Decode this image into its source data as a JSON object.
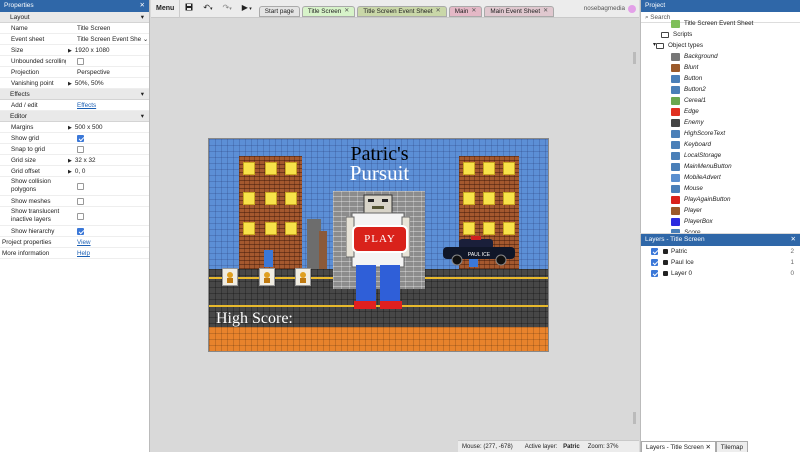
{
  "properties": {
    "title": "Properties",
    "sections": {
      "layout": "Layout",
      "effects": "Effects",
      "editor": "Editor"
    },
    "layout_rows": [
      {
        "key": "Name",
        "value": "Title Screen"
      },
      {
        "key": "Event sheet",
        "value": "Title Screen Event She"
      },
      {
        "key": "Size",
        "value": "1920 x 1080"
      },
      {
        "key": "Unbounded scrolling",
        "value": ""
      },
      {
        "key": "Projection",
        "value": "Perspective"
      },
      {
        "key": "Vanishing point",
        "value": "50%, 50%"
      }
    ],
    "effects_rows": [
      {
        "key": "Add / edit",
        "value": "Effects"
      }
    ],
    "editor_rows": [
      {
        "key": "Margins",
        "value": "500 x 500"
      },
      {
        "key": "Show grid",
        "value": ""
      },
      {
        "key": "Snap to grid",
        "value": ""
      },
      {
        "key": "Grid size",
        "value": "32 x 32"
      },
      {
        "key": "Grid offset",
        "value": "0, 0"
      },
      {
        "key": "Show collision polygons",
        "value": ""
      },
      {
        "key": "Show meshes",
        "value": ""
      },
      {
        "key": "Show translucent inactive layers",
        "value": ""
      },
      {
        "key": "Show hierarchy",
        "value": ""
      }
    ],
    "footer_rows": [
      {
        "key": "Project properties",
        "value": "View"
      },
      {
        "key": "More information",
        "value": "Help"
      }
    ],
    "checks": {
      "unbounded_scrolling": false,
      "show_grid": true,
      "snap_to_grid": false,
      "show_collision_polygons": false,
      "show_meshes": false,
      "show_translucent_inactive_layers": false,
      "show_hierarchy": true
    }
  },
  "toolbar": {
    "menu_label": "Menu",
    "save_icon": "save-icon",
    "undo_icon": "undo-icon",
    "redo_icon": "redo-icon",
    "play_icon": "play-icon"
  },
  "tabs": [
    {
      "label": "Start page",
      "color": "#e4e4e4",
      "closable": false
    },
    {
      "label": "Title Screen",
      "color": "#d7f3c9",
      "closable": true
    },
    {
      "label": "Title Screen Event Sheet",
      "color": "#c9d7a8",
      "closable": true
    },
    {
      "label": "Main",
      "color": "#e4b8c6",
      "closable": true
    },
    {
      "label": "Main Event Sheet",
      "color": "#e0c8cf",
      "closable": true
    }
  ],
  "user": "nosebagmedia",
  "scene": {
    "title_line1": "Patric's",
    "title_line2": "Pursuit",
    "play_label": "PLAY",
    "high_score_label": "High Score:",
    "car_label": "PAUL ICE"
  },
  "status": {
    "mouse": "Mouse: (277, -678)",
    "active_layer_label": "Active layer:",
    "active_layer_value": "Patric",
    "zoom": "Zoom: 37%"
  },
  "project": {
    "title": "Project",
    "search_placeholder": "Search",
    "items": [
      {
        "label": "Title Screen Event Sheet",
        "kind": "sheet",
        "icon_color": "#7fbf5a"
      },
      {
        "label": "Scripts",
        "kind": "folder",
        "icon_color": ""
      },
      {
        "label": "Object types",
        "kind": "folder-open",
        "icon_color": ""
      },
      {
        "label": "Background",
        "kind": "obj",
        "icon_color": "#777"
      },
      {
        "label": "Blunt",
        "kind": "obj",
        "icon_color": "#9b5a2a"
      },
      {
        "label": "Button",
        "kind": "obj",
        "icon_color": "#4a7fb8"
      },
      {
        "label": "Button2",
        "kind": "obj",
        "icon_color": "#4a7fb8"
      },
      {
        "label": "Cereal1",
        "kind": "obj",
        "icon_color": "#6aa84f"
      },
      {
        "label": "Edge",
        "kind": "obj",
        "icon_color": "#e03020"
      },
      {
        "label": "Enemy",
        "kind": "obj",
        "icon_color": "#444"
      },
      {
        "label": "HighScoreText",
        "kind": "obj",
        "icon_color": "#4a7fb8"
      },
      {
        "label": "Keyboard",
        "kind": "obj",
        "icon_color": "#4a7fb8"
      },
      {
        "label": "LocalStorage",
        "kind": "obj",
        "icon_color": "#4a7fb8"
      },
      {
        "label": "MainMenuButton",
        "kind": "obj",
        "icon_color": "#4a7fb8"
      },
      {
        "label": "MobileAdvert",
        "kind": "obj",
        "icon_color": "#5a8fcf"
      },
      {
        "label": "Mouse",
        "kind": "obj",
        "icon_color": "#4a7fb8"
      },
      {
        "label": "PlayAgainButton",
        "kind": "obj",
        "icon_color": "#d9221b"
      },
      {
        "label": "Player",
        "kind": "obj",
        "icon_color": "#9b5a2a"
      },
      {
        "label": "PlayerBox",
        "kind": "obj",
        "icon_color": "#2b2be0"
      },
      {
        "label": "Score",
        "kind": "obj",
        "icon_color": "#4a7fb8"
      }
    ]
  },
  "layers": {
    "title": "Layers - Title Screen",
    "items": [
      {
        "name": "Patric",
        "index": "2"
      },
      {
        "name": "Paul Ice",
        "index": "1"
      },
      {
        "name": "Layer 0",
        "index": "0"
      }
    ],
    "bottom_tabs": [
      "Layers - Title Screen",
      "Tilemap"
    ]
  }
}
